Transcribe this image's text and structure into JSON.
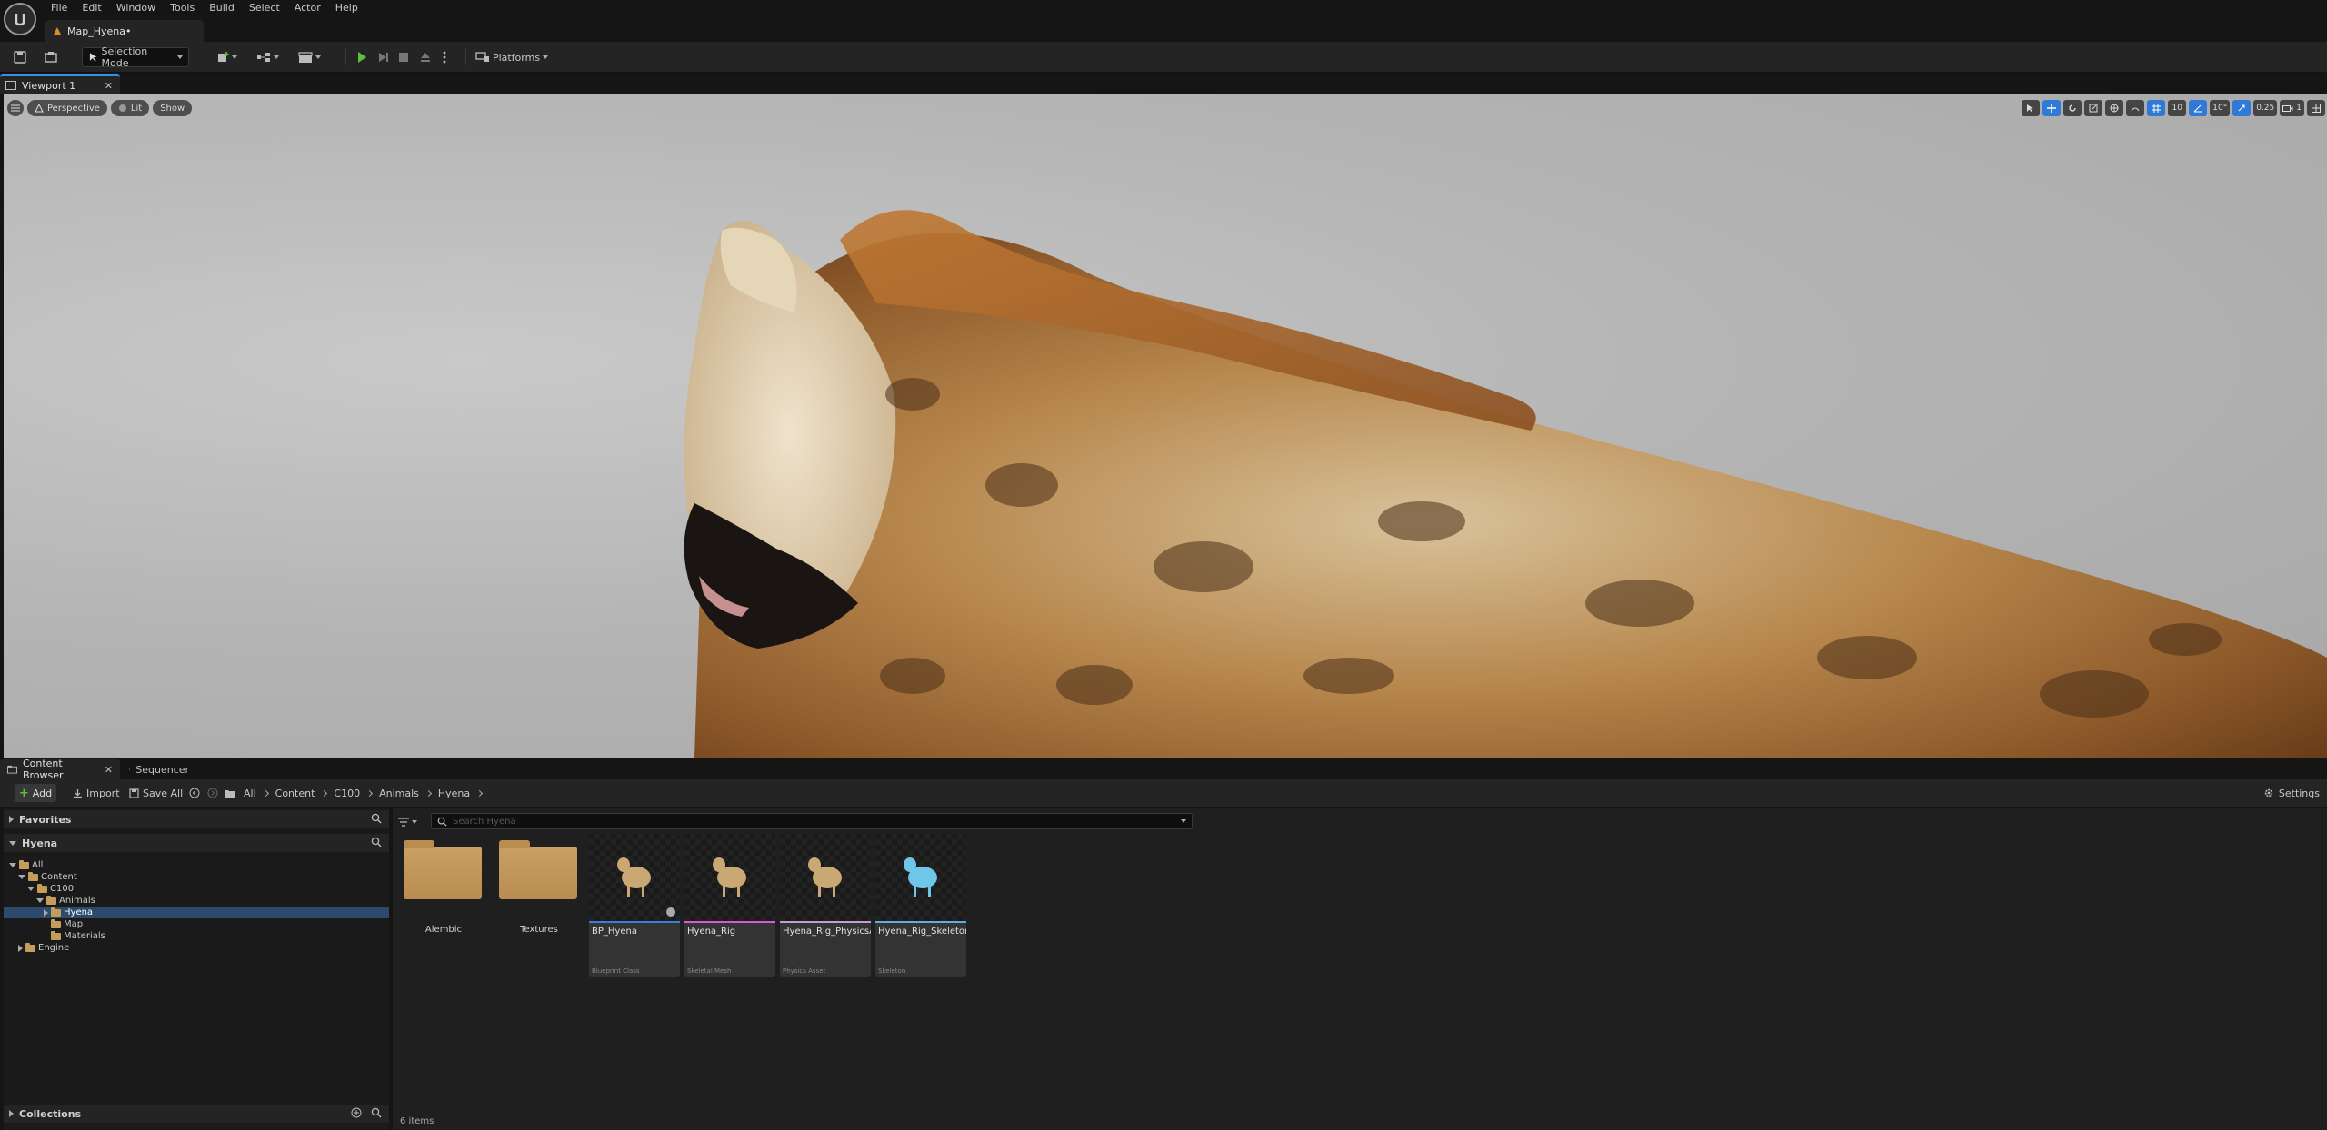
{
  "menu": [
    "File",
    "Edit",
    "Window",
    "Tools",
    "Build",
    "Select",
    "Actor",
    "Help"
  ],
  "document_tab": {
    "label": "Map_Hyena•"
  },
  "toolbar": {
    "selection_mode": "Selection Mode",
    "platforms": "Platforms"
  },
  "viewport": {
    "tab_label": "Viewport 1",
    "perspective": "Perspective",
    "lit": "Lit",
    "show": "Show",
    "grid_snap": "10",
    "rotation_snap": "10°",
    "scale_snap": "0.25",
    "camera_speed": "1"
  },
  "content_browser": {
    "tab_label": "Content Browser",
    "sequencer_tab": "Sequencer",
    "add": "Add",
    "import": "Import",
    "save_all": "Save All",
    "breadcrumb": [
      "All",
      "Content",
      "C100",
      "Animals",
      "Hyena"
    ],
    "settings": "Settings",
    "favorites": "Favorites",
    "source_root": "Hyena",
    "tree": [
      {
        "label": "All",
        "depth": 0,
        "expanded": true
      },
      {
        "label": "Content",
        "depth": 1,
        "expanded": true
      },
      {
        "label": "C100",
        "depth": 2,
        "expanded": true
      },
      {
        "label": "Animals",
        "depth": 3,
        "expanded": true
      },
      {
        "label": "Hyena",
        "depth": 4,
        "expanded": false,
        "selected": true
      },
      {
        "label": "Map",
        "depth": 4
      },
      {
        "label": "Materials",
        "depth": 4
      },
      {
        "label": "Engine",
        "depth": 1,
        "expanded": false
      }
    ],
    "collections": "Collections",
    "search_placeholder": "Search Hyena",
    "folders": [
      {
        "name": "Alembic"
      },
      {
        "name": "Textures"
      }
    ],
    "assets": [
      {
        "name": "BP_Hyena",
        "type": "Blueprint Class",
        "color": "#3a7fd6"
      },
      {
        "name": "Hyena_Rig",
        "type": "Skeletal Mesh",
        "color": "#d65ad6"
      },
      {
        "name": "Hyena_Rig_PhysicsAsset",
        "type": "Physics Asset",
        "color": "#c0a0d0"
      },
      {
        "name": "Hyena_Rig_Skeleton",
        "type": "Skeleton",
        "color": "#5ab0e0"
      }
    ],
    "item_count": "6 items"
  }
}
